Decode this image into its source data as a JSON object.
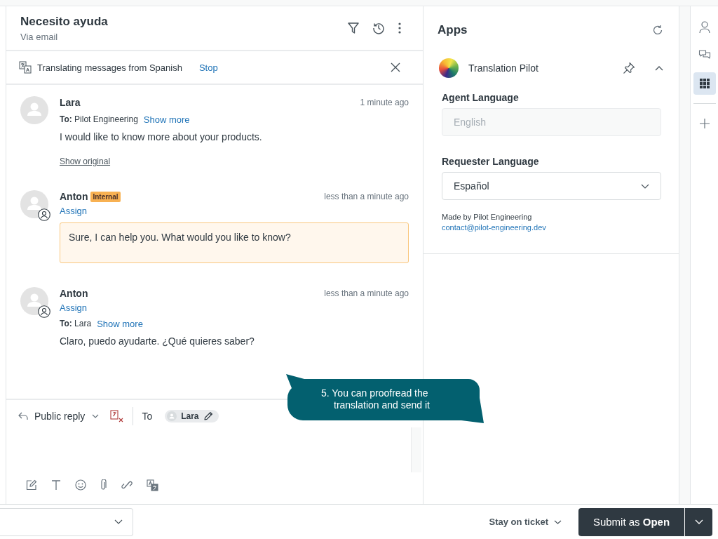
{
  "ticket": {
    "title": "Necesito ayuda",
    "channel": "Via email"
  },
  "translation_bar": {
    "text": "Translating messages from Spanish",
    "action": "Stop"
  },
  "messages": [
    {
      "author": "Lara",
      "time": "1 minute ago",
      "recipient": "**To:** Pilot Engineering",
      "show_more": "Show more",
      "body": "I would like to know more about your products.",
      "kind": "public",
      "show_original": "Show original"
    },
    {
      "author": "Anton",
      "badge": "Internal",
      "time": "less than a minute ago",
      "assign": "Assign",
      "body": "Sure, I can help you. What would you like to know?",
      "kind": "internal"
    },
    {
      "author": "Anton",
      "time": "less than a minute ago",
      "assign": "Assign",
      "recipient": "**To:** Lara",
      "show_more": "Show more",
      "body": "Claro, puedo ayudarte. ¿Qué quieres saber?",
      "kind": "public"
    }
  ],
  "composer": {
    "mode": "Public reply",
    "to_label": "To",
    "recipient": "Lara"
  },
  "tooltip": {
    "text": "5. You can proofread the translation and send it"
  },
  "apps": {
    "title": "Apps",
    "app": {
      "name": "Translation Pilot",
      "expanded": true
    },
    "agent_language": {
      "label": "Agent Language",
      "value": "English",
      "disabled": true
    },
    "requester_language": {
      "label": "Requester Language",
      "value": "Español"
    },
    "credit": "Made by Pilot Engineering",
    "contact": "contact@pilot-engineering.dev"
  },
  "rail": [
    {
      "kind": "person",
      "selected": false
    },
    {
      "kind": "chat",
      "selected": false
    },
    {
      "kind": "apps",
      "selected": true
    },
    {
      "kind": "add",
      "selected": false
    }
  ],
  "footer": {
    "stay": "Stay on ticket",
    "submit": "Submit as **Open**"
  }
}
